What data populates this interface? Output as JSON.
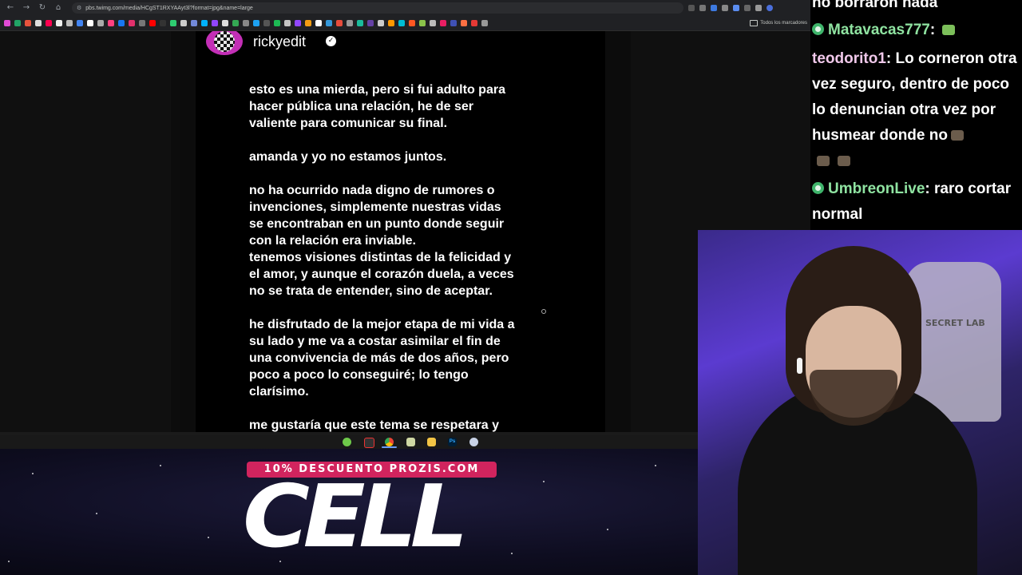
{
  "browser": {
    "url": "pbs.twimg.com/media/HCgST1RXYAAyt3l?format=jpg&name=large",
    "bookmarks_all_label": "Todos los marcadores",
    "nav": {
      "back": "←",
      "forward": "→",
      "reload": "↻",
      "home": "⌂"
    }
  },
  "post": {
    "username": "rickyedit",
    "verified_glyph": "✓",
    "paragraphs": [
      "esto es una mierda, pero si fui adulto para\nhacer pública una relación, he de ser\nvaliente para comunicar su final.",
      "amanda y yo no estamos juntos.",
      "no ha ocurrido nada digno de rumores o\ninvenciones, simplemente nuestras vidas\nse encontraban en un punto donde seguir\ncon la relación era inviable.\ntenemos visiones distintas de la felicidad y\nel amor, y aunque el corazón duela, a veces\nno se trata de entender, sino de aceptar.",
      "he disfrutado de la mejor etapa de mi vida a\nsu lado y me va a costar asimilar el fin de\nuna convivencia de más de dos años, pero\npoco a poco lo conseguiré; lo tengo\nclarísimo.",
      "me gustaría que este tema se respetara y"
    ]
  },
  "taskbar": {
    "ps_label": "Ps"
  },
  "promo": {
    "badge": "10% DESCUENTO PROZIS.COM",
    "brand": "CELL"
  },
  "chat": {
    "messages": [
      {
        "user": "",
        "text": "no borraron nada"
      },
      {
        "user": "Matavacas777",
        "text": ": "
      },
      {
        "user": "teodorito1",
        "text": ": Lo corneron otra vez seguro, dentro de poco lo denuncian otra vez por husmear donde no"
      },
      {
        "user": "UmbreonLive",
        "text": ": raro cortar normal"
      }
    ],
    "colors": {
      "matavacas": "#8fe3a1",
      "teodorito": "#f0c8ea",
      "umbreon": "#8fe3a1",
      "badge": "#3fb46b"
    }
  },
  "webcam": {
    "chair_text": "SECRET LAB"
  },
  "colors": {
    "promo_pink": "#d1245e",
    "avatar_pink": "#c32fb6",
    "webcam_purple": "#5b3bd0"
  }
}
